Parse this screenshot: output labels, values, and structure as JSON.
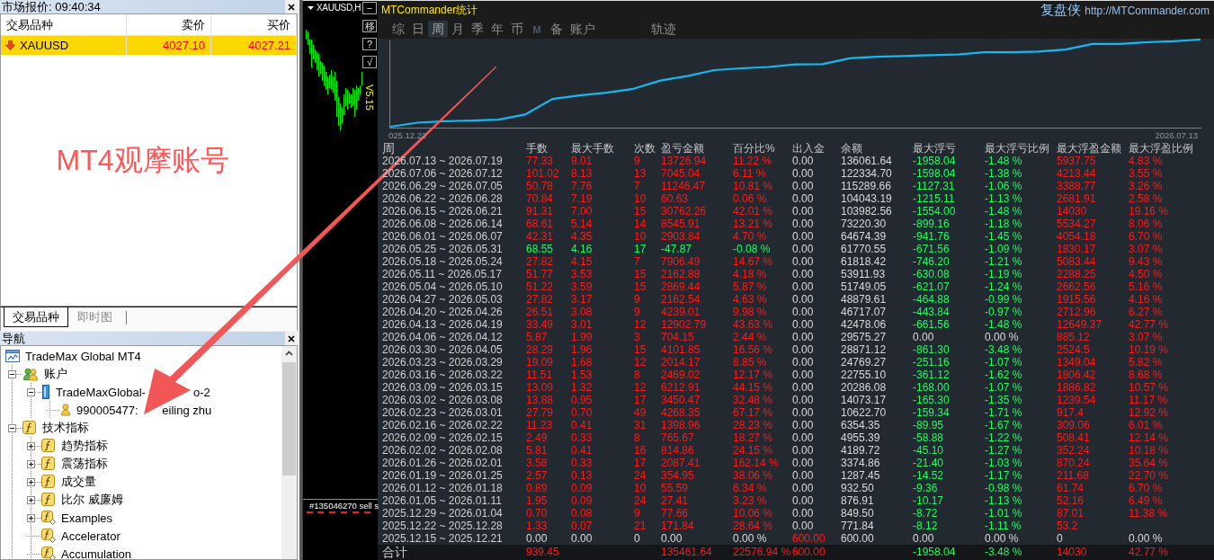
{
  "market_watch": {
    "title": "市场报价: 09:40:34",
    "columns": [
      "交易品种",
      "卖价",
      "买价"
    ],
    "rows": [
      {
        "symbol": "XAUUSD",
        "bid": "4027.10",
        "ask": "4027.21",
        "rising": false,
        "selected": true
      }
    ],
    "note": "MT4观摩账号",
    "tabs": [
      {
        "label": "交易品种",
        "selected": true
      },
      {
        "label": "即时图",
        "selected": false
      }
    ]
  },
  "navigator": {
    "title": "导航",
    "tree": [
      {
        "label": "TradeMax Global MT4",
        "kind": "terminal",
        "children": [
          {
            "label": "账户",
            "kind": "accounts",
            "expanded": true,
            "children": [
              {
                "label": "TradeMaxGlobal-",
                "label_tail": "o-2",
                "kind": "server",
                "expanded": true,
                "children": [
                  {
                    "label": "990005477:",
                    "label_tail": "eiling zhu",
                    "kind": "account"
                  }
                ]
              }
            ]
          },
          {
            "label": "技术指标",
            "kind": "indicators",
            "expanded": true,
            "children": [
              {
                "label": "趋势指标",
                "kind": "indicators",
                "expanded": false
              },
              {
                "label": "震荡指标",
                "kind": "indicators",
                "expanded": false
              },
              {
                "label": "成交量",
                "kind": "indicators",
                "expanded": false
              },
              {
                "label": "比尔 威廉姆",
                "kind": "indicators",
                "expanded": false
              },
              {
                "label": "Examples",
                "kind": "custom",
                "expanded": false
              },
              {
                "label": "Accelerator",
                "kind": "custom"
              },
              {
                "label": "Accumulation",
                "kind": "custom"
              }
            ]
          }
        ]
      }
    ]
  },
  "price_chart": {
    "title": "XAUUSD,H",
    "buttons": [
      "−",
      "移",
      "?",
      "√"
    ],
    "version": "V5.15",
    "order_label": "#135046270 sell s"
  },
  "stats": {
    "title": "MTCommander统计",
    "brand": "复盘侠",
    "link": "http://MTCommander.com",
    "tabs": [
      {
        "label": "综",
        "selected": false,
        "disabled": false
      },
      {
        "label": "日",
        "selected": false,
        "disabled": false
      },
      {
        "label": "周",
        "selected": true,
        "disabled": false
      },
      {
        "label": "月",
        "selected": false,
        "disabled": false
      },
      {
        "label": "季",
        "selected": false,
        "disabled": false
      },
      {
        "label": "年",
        "selected": false,
        "disabled": false
      },
      {
        "label": "币",
        "selected": false,
        "disabled": false
      },
      {
        "label": "M",
        "selected": false,
        "disabled": true
      },
      {
        "label": "备",
        "selected": false,
        "disabled": false
      },
      {
        "label": "账户",
        "selected": false,
        "disabled": false
      }
    ],
    "trace_label": "轨迹",
    "chart": {
      "start_label": "025.12.22",
      "end_label": "2026.07.13"
    },
    "table": {
      "columns": [
        "周",
        "手数",
        "最大手数",
        "次数",
        "盈亏金额",
        "百分比%",
        "出入金",
        "余额",
        "最大浮亏",
        "最大浮亏比例",
        "最大浮盈金额",
        "最大浮盈比例"
      ],
      "rows": [
        {
          "week": "2026.07.13 ~ 2026.07.19",
          "values": [
            "77.33",
            "9.01",
            "9",
            "13726.94",
            "11.22 %",
            "0.00",
            "136061.64",
            "-1958.04",
            "-1.48 %",
            "5937.75",
            "4.83 %"
          ],
          "kind": "gain",
          "deposit": false,
          "drawdown": true,
          "runup": true
        },
        {
          "week": "2026.07.06 ~ 2026.07.12",
          "values": [
            "101.02",
            "8.13",
            "13",
            "7045.04",
            "6.11 %",
            "0.00",
            "122334.70",
            "-1598.04",
            "-1.38 %",
            "4213.44",
            "3.55 %"
          ],
          "kind": "gain",
          "deposit": false,
          "drawdown": true,
          "runup": true
        },
        {
          "week": "2026.06.29 ~ 2026.07.05",
          "values": [
            "50.78",
            "7.76",
            "7",
            "11246.47",
            "10.81 %",
            "0.00",
            "115289.66",
            "-1127.31",
            "-1.06 %",
            "3388.77",
            "3.26 %"
          ],
          "kind": "gain",
          "deposit": false,
          "drawdown": true,
          "runup": true
        },
        {
          "week": "2026.06.22 ~ 2026.06.28",
          "values": [
            "70.84",
            "7.19",
            "10",
            "60.63",
            "0.06 %",
            "0.00",
            "104043.19",
            "-1215.11",
            "-1.13 %",
            "2681.91",
            "2.58 %"
          ],
          "kind": "gain",
          "deposit": false,
          "drawdown": true,
          "runup": true
        },
        {
          "week": "2026.06.15 ~ 2026.06.21",
          "values": [
            "91.31",
            "7.00",
            "15",
            "30762.26",
            "42.01 %",
            "0.00",
            "103982.56",
            "-1554.00",
            "-1.48 %",
            "14030",
            "19.16 %"
          ],
          "kind": "gain",
          "deposit": false,
          "drawdown": true,
          "runup": true
        },
        {
          "week": "2026.06.08 ~ 2026.06.14",
          "values": [
            "68.61",
            "5.14",
            "14",
            "8545.91",
            "13.21 %",
            "0.00",
            "73220.30",
            "-899.16",
            "-1.18 %",
            "5534.27",
            "8.06 %"
          ],
          "kind": "gain",
          "deposit": false,
          "drawdown": true,
          "runup": true
        },
        {
          "week": "2026.06.01 ~ 2026.06.07",
          "values": [
            "42.31",
            "4.35",
            "10",
            "2903.84",
            "4.70 %",
            "0.00",
            "64674.39",
            "-941.76",
            "-1.45 %",
            "4054.18",
            "6.70 %"
          ],
          "kind": "gain",
          "deposit": false,
          "drawdown": true,
          "runup": true
        },
        {
          "week": "2026.05.25 ~ 2026.05.31",
          "values": [
            "68.55",
            "4.16",
            "17",
            "-47.87",
            "-0.08 %",
            "0.00",
            "61770.55",
            "-671.56",
            "-1.09 %",
            "1830.17",
            "3.07 %"
          ],
          "kind": "loss",
          "deposit": false,
          "drawdown": true,
          "runup": true
        },
        {
          "week": "2026.05.18 ~ 2026.05.24",
          "values": [
            "27.82",
            "4.15",
            "7",
            "7906.49",
            "14.67 %",
            "0.00",
            "61818.42",
            "-746.20",
            "-1.21 %",
            "5083.44",
            "9.43 %"
          ],
          "kind": "gain",
          "deposit": false,
          "drawdown": true,
          "runup": true
        },
        {
          "week": "2026.05.11 ~ 2026.05.17",
          "values": [
            "51.77",
            "3.53",
            "15",
            "2162.88",
            "4.18 %",
            "0.00",
            "53911.93",
            "-630.08",
            "-1.19 %",
            "2288.25",
            "4.50 %"
          ],
          "kind": "gain",
          "deposit": false,
          "drawdown": true,
          "runup": true
        },
        {
          "week": "2026.05.04 ~ 2026.05.10",
          "values": [
            "51.22",
            "3.59",
            "15",
            "2869.44",
            "5.87 %",
            "0.00",
            "51749.05",
            "-621.07",
            "-1.24 %",
            "2662.56",
            "5.16 %"
          ],
          "kind": "gain",
          "deposit": false,
          "drawdown": true,
          "runup": true
        },
        {
          "week": "2026.04.27 ~ 2026.05.03",
          "values": [
            "27.82",
            "3.17",
            "9",
            "2162.54",
            "4.63 %",
            "0.00",
            "48879.61",
            "-464.88",
            "-0.99 %",
            "1915.56",
            "4.16 %"
          ],
          "kind": "gain",
          "deposit": false,
          "drawdown": true,
          "runup": true
        },
        {
          "week": "2026.04.20 ~ 2026.04.26",
          "values": [
            "26.51",
            "3.08",
            "9",
            "4239.01",
            "9.98 %",
            "0.00",
            "46717.07",
            "-443.84",
            "-0.97 %",
            "2712.96",
            "6.27 %"
          ],
          "kind": "gain",
          "deposit": false,
          "drawdown": true,
          "runup": true
        },
        {
          "week": "2026.04.13 ~ 2026.04.19",
          "values": [
            "33.49",
            "3.01",
            "12",
            "12902.79",
            "43.63 %",
            "0.00",
            "42478.06",
            "-661.56",
            "-1.48 %",
            "12649.37",
            "42.77 %"
          ],
          "kind": "gain",
          "deposit": false,
          "drawdown": true,
          "runup": true
        },
        {
          "week": "2026.04.06 ~ 2026.04.12",
          "values": [
            "5.87",
            "1.99",
            "3",
            "704.15",
            "2.44 %",
            "0.00",
            "29575.27",
            "0.00",
            "0.00 %",
            "885.12",
            "3.07 %"
          ],
          "kind": "gain",
          "deposit": false,
          "drawdown": false,
          "runup": true
        },
        {
          "week": "2026.03.30 ~ 2026.04.05",
          "values": [
            "28.29",
            "1.96",
            "15",
            "4101.85",
            "16.56 %",
            "0.00",
            "28871.12",
            "-861.30",
            "-3.48 %",
            "2524.5",
            "10.19 %"
          ],
          "kind": "gain",
          "deposit": false,
          "drawdown": true,
          "runup": true
        },
        {
          "week": "2026.03.23 ~ 2026.03.29",
          "values": [
            "19.09",
            "1.68",
            "12",
            "2014.17",
            "8.85 %",
            "0.00",
            "24769.27",
            "-251.16",
            "-1.07 %",
            "1349.04",
            "5.82 %"
          ],
          "kind": "gain",
          "deposit": false,
          "drawdown": true,
          "runup": true
        },
        {
          "week": "2026.03.16 ~ 2026.03.22",
          "values": [
            "11.51",
            "1.53",
            "8",
            "2469.02",
            "12.17 %",
            "0.00",
            "22755.10",
            "-361.12",
            "-1.62 %",
            "1806.42",
            "8.68 %"
          ],
          "kind": "gain",
          "deposit": false,
          "drawdown": true,
          "runup": true
        },
        {
          "week": "2026.03.09 ~ 2026.03.15",
          "values": [
            "13.09",
            "1.32",
            "12",
            "6212.91",
            "44.15 %",
            "0.00",
            "20286.08",
            "-168.00",
            "-1.07 %",
            "1886.82",
            "10.57 %"
          ],
          "kind": "gain",
          "deposit": false,
          "drawdown": true,
          "runup": true
        },
        {
          "week": "2026.03.02 ~ 2026.03.08",
          "values": [
            "13.88",
            "0.95",
            "17",
            "3450.47",
            "32.48 %",
            "0.00",
            "14073.17",
            "-165.30",
            "-1.35 %",
            "1239.54",
            "11.17 %"
          ],
          "kind": "gain",
          "deposit": false,
          "drawdown": true,
          "runup": true
        },
        {
          "week": "2026.02.23 ~ 2026.03.01",
          "values": [
            "27.79",
            "0.70",
            "49",
            "4268.35",
            "67.17 %",
            "0.00",
            "10622.70",
            "-159.34",
            "-1.71 %",
            "917.4",
            "12.92 %"
          ],
          "kind": "gain",
          "deposit": false,
          "drawdown": true,
          "runup": true
        },
        {
          "week": "2026.02.16 ~ 2026.02.22",
          "values": [
            "11.23",
            "0.41",
            "31",
            "1398.96",
            "28.23 %",
            "0.00",
            "6354.35",
            "-89.95",
            "-1.67 %",
            "309.06",
            "6.01 %"
          ],
          "kind": "gain",
          "deposit": false,
          "drawdown": true,
          "runup": true
        },
        {
          "week": "2026.02.09 ~ 2026.02.15",
          "values": [
            "2.49",
            "0.33",
            "8",
            "765.67",
            "18.27 %",
            "0.00",
            "4955.39",
            "-58.88",
            "-1.22 %",
            "508.41",
            "12.14 %"
          ],
          "kind": "gain",
          "deposit": false,
          "drawdown": true,
          "runup": true
        },
        {
          "week": "2026.02.02 ~ 2026.02.08",
          "values": [
            "5.81",
            "0.41",
            "16",
            "814.86",
            "24.15 %",
            "0.00",
            "4189.72",
            "-45.10",
            "-1.27 %",
            "352.24",
            "10.18 %"
          ],
          "kind": "gain",
          "deposit": false,
          "drawdown": true,
          "runup": true
        },
        {
          "week": "2026.01.26 ~ 2026.02.01",
          "values": [
            "3.58",
            "0.33",
            "17",
            "2087.41",
            "162.14 %",
            "0.00",
            "3374.86",
            "-21.40",
            "-1.03 %",
            "870.24",
            "35.64 %"
          ],
          "kind": "gain",
          "deposit": false,
          "drawdown": true,
          "runup": true
        },
        {
          "week": "2026.01.19 ~ 2026.01.25",
          "values": [
            "2.57",
            "0.13",
            "24",
            "354.95",
            "38.06 %",
            "0.00",
            "1287.45",
            "-14.52",
            "-1.17 %",
            "211.68",
            "22.70 %"
          ],
          "kind": "gain",
          "deposit": false,
          "drawdown": true,
          "runup": true
        },
        {
          "week": "2026.01.12 ~ 2026.01.18",
          "values": [
            "0.89",
            "0.09",
            "10",
            "55.59",
            "6.34 %",
            "0.00",
            "932.50",
            "-9.36",
            "-0.98 %",
            "61.74",
            "6.70 %"
          ],
          "kind": "gain",
          "deposit": false,
          "drawdown": true,
          "runup": true
        },
        {
          "week": "2026.01.05 ~ 2026.01.11",
          "values": [
            "1.95",
            "0.09",
            "24",
            "27.41",
            "3.23 %",
            "0.00",
            "876.91",
            "-10.17",
            "-1.13 %",
            "52.16",
            "6.49 %"
          ],
          "kind": "gain",
          "deposit": false,
          "drawdown": true,
          "runup": true
        },
        {
          "week": "2025.12.29 ~ 2026.01.04",
          "values": [
            "0.70",
            "0.08",
            "9",
            "77.66",
            "10.06 %",
            "0.00",
            "849.50",
            "-8.72",
            "-1.01 %",
            "87.01",
            "11.38 %"
          ],
          "kind": "gain",
          "deposit": false,
          "drawdown": true,
          "runup": true
        },
        {
          "week": "2025.12.22 ~ 2025.12.28",
          "values": [
            "1.33",
            "0.07",
            "21",
            "171.84",
            "28.64 %",
            "0.00",
            "771.84",
            "-8.12",
            "-1.11 %",
            "53.2"
          ],
          "kind": "gain",
          "deposit": false,
          "drawdown": true,
          "runup": true
        },
        {
          "week": "2025.12.15 ~ 2025.12.21",
          "values": [
            "0.00",
            "0.00",
            "0",
            "0.00",
            "0.00 %",
            "600.00",
            "600.00",
            "0.00",
            "0.00 %",
            "0",
            "0.00 %"
          ],
          "kind": "flat",
          "deposit": true,
          "drawdown": false,
          "runup": false
        }
      ],
      "total": {
        "label": "合计",
        "values": {
          "lots": "939.45",
          "profit": "135461.64",
          "percent": "22576.94 %",
          "transfer": "600.00",
          "max_drawdown": "-1958.04",
          "max_drawdown_pct": "-3.48 %",
          "max_runup": "14030",
          "max_runup_pct": "42.77 %"
        },
        "kind": "gain",
        "deposit": true,
        "drawdown": true,
        "runup": true
      }
    }
  }
}
